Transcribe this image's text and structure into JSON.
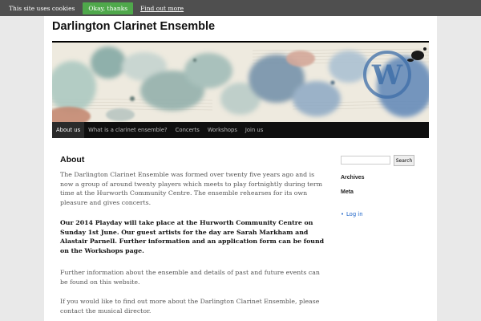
{
  "cookie_bar": {
    "message": "This site uses cookies",
    "accept_label": "Okay, thanks",
    "more_label": "Find out more"
  },
  "site": {
    "title": "Darlington Clarinet Ensemble"
  },
  "banner_text": "W",
  "nav": {
    "items": [
      {
        "label": "About us",
        "current": true
      },
      {
        "label": "What is a clarinet ensemble?"
      },
      {
        "label": "Concerts"
      },
      {
        "label": "Workshops"
      },
      {
        "label": "Join us"
      }
    ]
  },
  "content": {
    "heading": "About",
    "paragraphs": [
      "The Darlington Clarinet Ensemble was formed over twenty five years ago and is now a group of around twenty players which meets to play fortnightly during term time at the Hurworth Community Centre.  The ensemble rehearses for its own pleasure and gives concerts.",
      "Our 2014 Playday will take place at the Hurworth Community Centre on Sunday 1st June. Our guest artists for the day are Sarah Markham and Alastair Parnell. Further information and an application form can be found on the ",
      "Further information about the ensemble and details of past and future events can be found on this website.",
      "If you would like to find out more about the Darlington Clarinet Ensemble, please contact the musical director."
    ],
    "workshops_link": "Workshops",
    "page_suffix": " page."
  },
  "sidebar": {
    "search_placeholder": "",
    "search_button": "Search",
    "archives_title": "Archives",
    "meta_title": "Meta",
    "meta_links": [
      "Log in"
    ]
  }
}
